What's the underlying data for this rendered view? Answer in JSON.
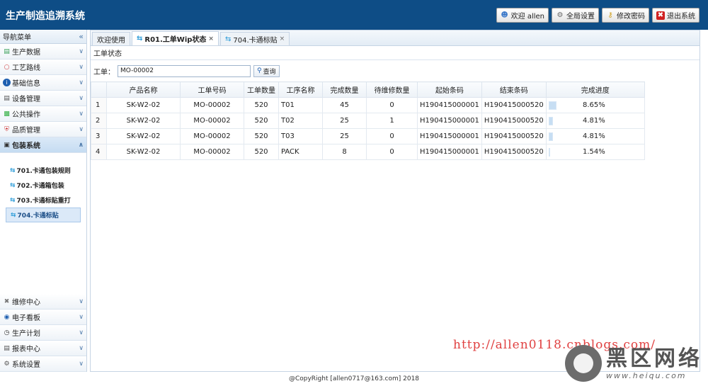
{
  "app": {
    "title": "生产制造追溯系统"
  },
  "header_buttons": [
    {
      "icon": "user-icon",
      "label": "欢迎 allen"
    },
    {
      "icon": "gear-icon",
      "label": "全局设置"
    },
    {
      "icon": "key-icon",
      "label": "修改密码"
    },
    {
      "icon": "exit-icon",
      "label": "退出系统"
    }
  ],
  "sidebar": {
    "heading": "导航菜单",
    "collapse_glyph": "«",
    "items_top": [
      {
        "icon": "doc-icon",
        "label": "生产数据"
      },
      {
        "icon": "route-icon",
        "label": "工艺路线"
      },
      {
        "icon": "info-icon",
        "label": "基础信息"
      },
      {
        "icon": "device-icon",
        "label": "设备管理"
      },
      {
        "icon": "puzzle-icon",
        "label": "公共操作"
      },
      {
        "icon": "shield-icon",
        "label": "品质管理"
      },
      {
        "icon": "package-icon",
        "label": "包装系统"
      }
    ],
    "submenu": [
      {
        "label": "701.卡通包装规则"
      },
      {
        "label": "702.卡通箱包装"
      },
      {
        "label": "703.卡通标贴重打"
      },
      {
        "label": "704.卡通标贴"
      }
    ],
    "items_bottom": [
      {
        "icon": "tools-icon",
        "label": "维修中心"
      },
      {
        "icon": "board-icon",
        "label": "电子看板"
      },
      {
        "icon": "clock-icon",
        "label": "生产计划"
      },
      {
        "icon": "report-icon",
        "label": "报表中心"
      },
      {
        "icon": "settings-icon",
        "label": "系统设置"
      }
    ]
  },
  "tabs": [
    {
      "label": "欢迎使用",
      "closable": false
    },
    {
      "label": "R01.工单Wip状态",
      "closable": true
    },
    {
      "label": "704.卡通标贴",
      "closable": true
    }
  ],
  "panel": {
    "title": "工单状态"
  },
  "query": {
    "label": "工单：",
    "value": "MO-00002",
    "button": "查询"
  },
  "table": {
    "columns": [
      "",
      "产品名称",
      "工单号码",
      "工单数量",
      "工序名称",
      "完成数量",
      "待维修数量",
      "起始条码",
      "结束条码",
      "完成进度"
    ],
    "rows": [
      {
        "no": "1",
        "product": "SK-W2-02",
        "order": "MO-00002",
        "qty": "520",
        "process": "T01",
        "done": "45",
        "repair": "0",
        "start": "H190415000001",
        "end": "H190415000520",
        "progress": 0.0865,
        "pct": "8.65%"
      },
      {
        "no": "2",
        "product": "SK-W2-02",
        "order": "MO-00002",
        "qty": "520",
        "process": "T02",
        "done": "25",
        "repair": "1",
        "start": "H190415000001",
        "end": "H190415000520",
        "progress": 0.0481,
        "pct": "4.81%"
      },
      {
        "no": "3",
        "product": "SK-W2-02",
        "order": "MO-00002",
        "qty": "520",
        "process": "T03",
        "done": "25",
        "repair": "0",
        "start": "H190415000001",
        "end": "H190415000520",
        "progress": 0.0481,
        "pct": "4.81%"
      },
      {
        "no": "4",
        "product": "SK-W2-02",
        "order": "MO-00002",
        "qty": "520",
        "process": "PACK",
        "done": "8",
        "repair": "0",
        "start": "H190415000001",
        "end": "H190415000520",
        "progress": 0.0154,
        "pct": "1.54%"
      }
    ]
  },
  "watermark": {
    "url": "http://allen0118.cnblogs.com/",
    "site_cn": "黑区网络",
    "site_url": "www.heiqu.com"
  },
  "footer": {
    "text": "@CopyRight [allen0717@163.com] 2018"
  }
}
